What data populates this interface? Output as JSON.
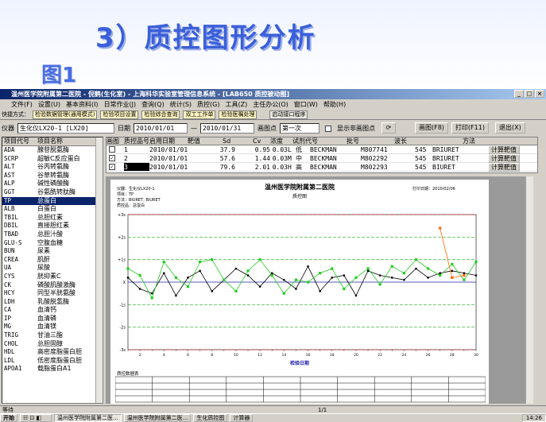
{
  "slide": {
    "title": "3）质控图形分析",
    "subtitle": "图1"
  },
  "window": {
    "title": "温州医学院附属第二医院 - 倪鹤(生化室) - 上海科华实验室管理信息系统 - [LAB650 质控被动图]"
  },
  "menu": [
    "文件(F)",
    "设置(U)",
    "基本资料(I)",
    "日常作业(J)",
    "查询(Q)",
    "统计(S)",
    "质控(G)",
    "工具(Z)",
    "主任办公(O)",
    "窗口(W)",
    "帮助(H)"
  ],
  "quickbar": {
    "label": "快捷方式：",
    "items": [
      "检验数据管理(通用模式)",
      "检验项目设置",
      "检验综合查询",
      "双工工作单",
      "检验医嘱处理"
    ],
    "right_item": "启动接口程序"
  },
  "controls": {
    "instrument_label": "仪器",
    "instrument_value": "生化仪LX20-1 [LX20]",
    "date_label": "日期",
    "date_from": "2010/01/01",
    "date_sep": "—",
    "date_to": "2010/01/31",
    "chart_point_label": "画图点",
    "chart_point_value": "第一次",
    "show_non_chart": "显示非画图点",
    "draw_button": "画图(F8)",
    "print_button": "打印(F11)",
    "exit_button": "退出(X)"
  },
  "item_list": {
    "headers": [
      "项目代号",
      "项目名称"
    ],
    "items": [
      [
        "ADA",
        "腺苷脱氨酶"
      ],
      [
        "SCRP",
        "超敏C反应蛋白"
      ],
      [
        "ALT",
        "谷丙转氨酶"
      ],
      [
        "AST",
        "谷草转氨酶"
      ],
      [
        "ALP",
        "碱性磷酸酶"
      ],
      [
        "GGT",
        "谷氨酰转肽酶"
      ],
      [
        "TP",
        "总蛋白"
      ],
      [
        "ALB",
        "白蛋白"
      ],
      [
        "TBIL",
        "总胆红素"
      ],
      [
        "DBIL",
        "直接胆红素"
      ],
      [
        "TBAD",
        "总胆汁酸"
      ],
      [
        "GLU-S",
        "空腹血糖"
      ],
      [
        "BUN",
        "尿素"
      ],
      [
        "CREA",
        "肌酐"
      ],
      [
        "UA",
        "尿酸"
      ],
      [
        "CYS",
        "胱抑素C"
      ],
      [
        "CK",
        "磷酸肌酸激酶"
      ],
      [
        "HCY",
        "同型半胱氨酸"
      ],
      [
        "LDH",
        "乳酸脱氢酶"
      ],
      [
        "CA",
        "血清钙"
      ],
      [
        "IP",
        "血清磷"
      ],
      [
        "MG",
        "血清镁"
      ],
      [
        "TRIG",
        "甘油三酯"
      ],
      [
        "CHOL",
        "总胆固醇"
      ],
      [
        "HDL",
        "高密度脂蛋白胆"
      ],
      [
        "LDL",
        "低密度脂蛋白胆"
      ],
      [
        "APOA1",
        "载脂蛋白A1"
      ]
    ],
    "selected_index": 6
  },
  "qc_table": {
    "headers": [
      "画图",
      "质控品号",
      "启用日期",
      "靶值",
      "Sd",
      "Cv",
      "浓度",
      "试剂代号",
      "批号",
      "波长",
      "方法"
    ],
    "rows": [
      {
        "num": "1",
        "checked": false,
        "date": "2010/01/01",
        "target": "37.9",
        "sd": "0.95",
        "cv": "0.03",
        "level": "L",
        "conc": "低",
        "reagent": "BECKMAN",
        "lot": "M807741",
        "wavelength": "545",
        "method": "BRIURET",
        "action": "计算靶值"
      },
      {
        "num": "2",
        "checked": true,
        "date": "2010/01/01",
        "target": "57.6",
        "sd": "1.44",
        "cv": "0.03",
        "level": "M",
        "conc": "中",
        "reagent": "BECKMAN",
        "lot": "M802292",
        "wavelength": "545",
        "method": "BRIURET",
        "action": "计算靶值"
      },
      {
        "num": "3",
        "checked": true,
        "date": "2010/01/01",
        "target": "79.6",
        "sd": "2.01",
        "cv": "0.03",
        "level": "H",
        "conc": "高",
        "reagent": "BECKMAN",
        "lot": "M802293",
        "wavelength": "545",
        "method": "BIURET",
        "action": "计算靶值"
      }
    ]
  },
  "report": {
    "hospital": "温州医学院附属第二医院",
    "chart_title": "质控图",
    "instrument_line": "仪器：生化仪LX20-1",
    "item_line": "项目：TP",
    "method_line": "方法：BIURET, BIURET",
    "qc_line": "质控品：总蛋白",
    "date_line": "打印日期：2010/02/06",
    "xlabel": "检验日期",
    "data_table_title": "质控数据表",
    "colors": {
      "series_low": "#000000",
      "series_mid": "#22cc22",
      "series_high": "#ff6600",
      "mean_line": "#2222aa",
      "sd_line": "#22aa22",
      "limit_line": "#cc2222"
    }
  },
  "chart_data": {
    "type": "line",
    "x": [
      1,
      2,
      3,
      4,
      5,
      6,
      7,
      8,
      9,
      10,
      11,
      12,
      13,
      14,
      15,
      16,
      17,
      18,
      19,
      20,
      21,
      22,
      23,
      24,
      25,
      26,
      27,
      28,
      29,
      30
    ],
    "xlim": [
      1,
      30
    ],
    "ylim": [
      -3,
      3
    ],
    "yticks": [
      "+3s",
      "+2s",
      "+1s",
      "X",
      "-1s",
      "-2s",
      "-3s"
    ],
    "series": [
      {
        "values": [
          0.2,
          -0.3,
          -0.5,
          0.4,
          -0.6,
          0.2,
          0.5,
          -0.4,
          0.1,
          0.6,
          0.3,
          -0.2,
          0.4,
          0.1,
          -0.3,
          0.7,
          -0.4,
          0.2,
          0.3,
          -0.6,
          0.5,
          0.3,
          0.2,
          0.1,
          0.6,
          0.2,
          0.4,
          0.5,
          0.4,
          0.3
        ]
      },
      {
        "values": [
          0.6,
          0.3,
          -0.7,
          0.9,
          0.2,
          -0.2,
          0.9,
          1.0,
          0.1,
          -0.4,
          0.5,
          1.0,
          0.3,
          -0.5,
          0.1,
          0.0,
          0.4,
          0.6,
          -0.3,
          0.2,
          0.6,
          -0.1,
          0.7,
          0.4,
          1.0,
          0.6,
          0.3,
          0.8,
          0.1,
          0.9
        ]
      },
      {
        "values": [
          null,
          null,
          null,
          null,
          null,
          null,
          null,
          null,
          null,
          null,
          null,
          null,
          null,
          null,
          null,
          null,
          null,
          null,
          null,
          null,
          null,
          null,
          null,
          null,
          null,
          null,
          2.4,
          0.2,
          0.3,
          null
        ]
      }
    ]
  },
  "status": {
    "left": "等待",
    "page": "1/1"
  },
  "taskbar": {
    "start": "开始",
    "tasks": [
      "温州医学院附属第二医...",
      "温州医学院附属第二医...",
      "生化质控图",
      "计算器"
    ],
    "clock": "14:26"
  }
}
